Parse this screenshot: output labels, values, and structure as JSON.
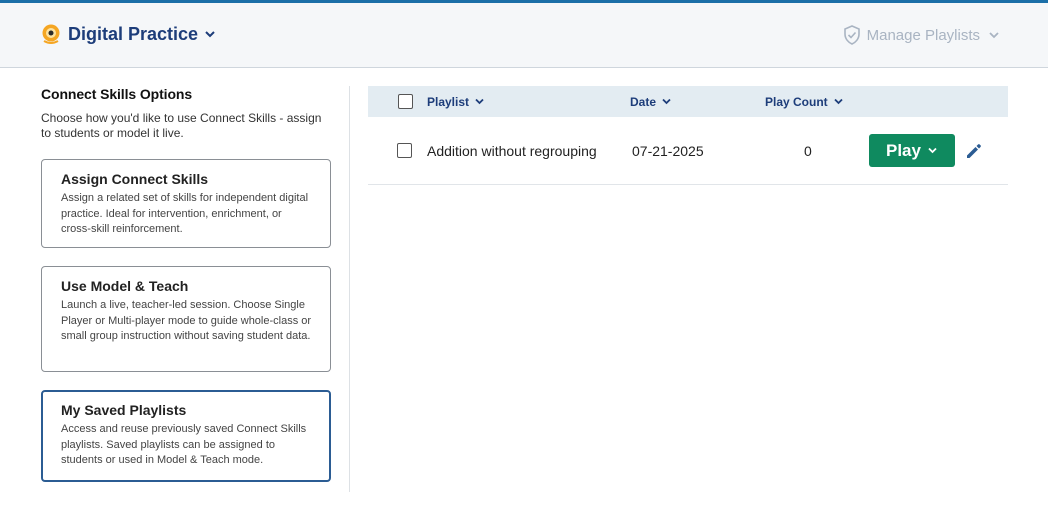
{
  "header": {
    "title": "Digital Practice",
    "manage_label": "Manage Playlists"
  },
  "left_panel": {
    "heading": "Connect Skills Options",
    "subtitle": "Choose how you'd like to use Connect Skills - assign to students or model it live.",
    "cards": [
      {
        "title": "Assign Connect Skills",
        "description": "Assign a related set of skills for independent digital practice. Ideal for intervention, enrichment, or cross-skill reinforcement."
      },
      {
        "title": "Use Model & Teach",
        "description": "Launch a live, teacher-led session. Choose Single Player or Multi-player mode to guide whole-class or small group instruction without saving student data."
      },
      {
        "title": "My Saved Playlists",
        "description": "Access and reuse previously saved Connect Skills playlists. Saved playlists can be assigned to students or used in Model & Teach mode."
      }
    ]
  },
  "table": {
    "columns": [
      "Playlist",
      "Date",
      "Play Count"
    ],
    "rows": [
      {
        "playlist": "Addition without regrouping",
        "date": "07-21-2025",
        "play_count": "0",
        "play_label": "Play"
      }
    ]
  },
  "colors": {
    "accent_top": "#1b6fa8",
    "title_navy": "#1d3d7a",
    "play_green": "#0f8a5f",
    "header_row": "#e3ecf2",
    "disabled_gray": "#a9b4c2"
  },
  "icons": {
    "brand": "digital-practice-logo-icon",
    "manage": "shield-check-icon",
    "edit": "pencil-icon",
    "dropdown": "chevron-down-icon"
  }
}
